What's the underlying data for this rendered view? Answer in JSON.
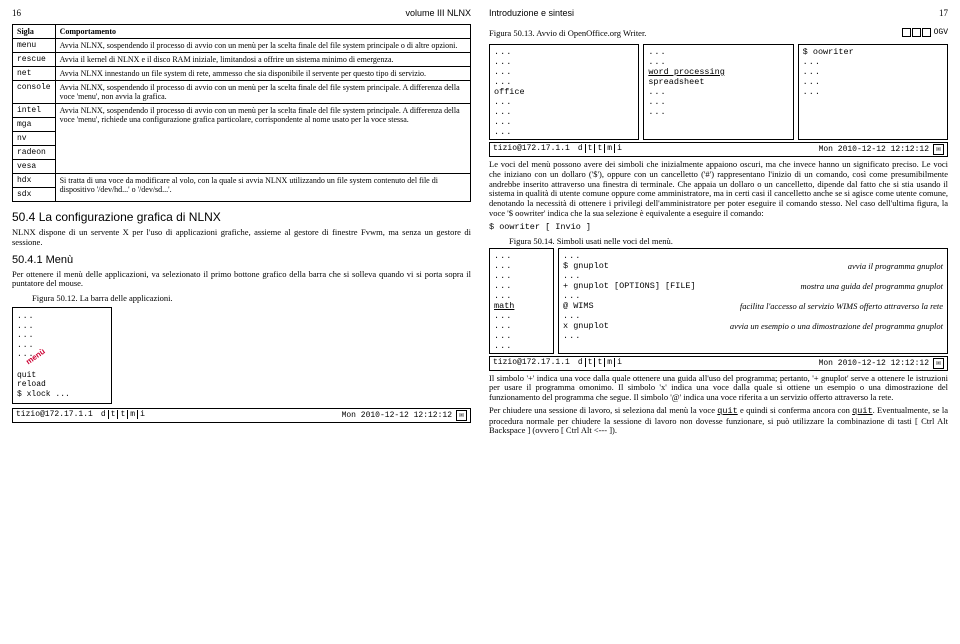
{
  "left_page": {
    "number": "16",
    "header": "volume III   NLNX",
    "sigla_header": "Sigla",
    "comp_header": "Comportamento",
    "rows": [
      {
        "sigla": "menu",
        "comp": "Avvia NLNX, sospendendo il processo di avvio con un menù per la scelta finale del file system principale o di altre opzioni."
      },
      {
        "sigla": "rescue",
        "comp": "Avvia il kernel di NLNX e il disco RAM iniziale, limitandosi a offrire un sistema minimo di emergenza."
      },
      {
        "sigla": "net",
        "comp": "Avvia NLNX innestando un file system di rete, ammesso che sia disponibile il servente per questo tipo di servizio."
      },
      {
        "sigla": "console",
        "comp": "Avvia NLNX, sospendendo il processo di avvio con un menù per la scelta finale del file system principale. A differenza della voce 'menu', non avvia la grafica."
      },
      {
        "sigla": "intel",
        "comp": ""
      },
      {
        "sigla": "mga",
        "comp": ""
      },
      {
        "sigla": "nv",
        "comp": "Avvia NLNX, sospendendo il processo di avvio con un menù per la scelta finale del file system principale. A differenza della voce 'menu', richiede una configurazione grafica particolare, corrispondente al nome usato per la voce stessa."
      },
      {
        "sigla": "radeon",
        "comp": ""
      },
      {
        "sigla": "vesa",
        "comp": ""
      },
      {
        "sigla": "hdx",
        "comp": "Si tratta di una voce da modificare al volo, con la quale si avvia NLNX utilizzando un file system contenuto del file di dispositivo '/dev/hd...' o '/dev/sd...'."
      },
      {
        "sigla": "sdx",
        "comp": ""
      }
    ],
    "sec_50_4": "50.4 La configurazione grafica di NLNX",
    "para_50_4": "NLNX dispone di un servente X per l'uso di applicazioni grafiche, assieme al gestore di finestre Fvwm, ma senza un gestore di sessione.",
    "sec_50_4_1": "50.4.1 Menù",
    "para_50_4_1": "Per ottenere il menù delle applicazioni, va selezionato il primo bottone grafico della barra che si solleva quando vi si porta sopra il puntatore del mouse.",
    "fig_50_12": "Figura 50.12. La barra delle applicazioni.",
    "menu_items": [
      "...",
      "...",
      "...",
      "...",
      "..."
    ],
    "menu_word": "menù",
    "menu_quit": "quit",
    "menu_reload": "reload",
    "menu_xlock": "$ xlock ...",
    "status_user": "tizio@172.17.1.1",
    "status_flags": [
      "d",
      "t",
      "t",
      "m",
      "i"
    ],
    "status_time": "Mon 2010-12-12 12:12:12"
  },
  "right_page": {
    "number": "17",
    "header": "Introduzione e sintesi",
    "fig_50_13": "Figura 50.13. Avvio di OpenOffice.org Writer.",
    "ogv": "OGV",
    "box1_col1": [
      "...",
      "...",
      "...",
      "...",
      "office",
      "...",
      "...",
      "...",
      "..."
    ],
    "box1_col2": [
      "...",
      "...",
      "word processing",
      "spreadsheet",
      "...",
      "...",
      "..."
    ],
    "box1_col3": [
      "$ oowriter",
      "...",
      "...",
      "...",
      "..."
    ],
    "status_user": "tizio@172.17.1.1",
    "status_flags": [
      "d",
      "t",
      "t",
      "m",
      "i"
    ],
    "status_time": "Mon 2010-12-12 12:12:12",
    "para1": "Le voci del menù possono avere dei simboli che inizialmente appaiono oscuri, ma che invece hanno un significato preciso. Le voci che iniziano con un dollaro ('$'), oppure con un cancelletto ('#') rappresentano l'inizio di un comando, così come presumibilmente andrebbe inserito attraverso una finestra di terminale. Che appaia un dollaro o un cancelletto, dipende dal fatto che si stia usando il sistema in qualità di utente comune oppure come amministratore, ma in certi casi il cancelletto anche se si agisce come utente comune, denotando la necessità di ottenere i privilegi dell'amministratore per poter eseguire il comando stesso. Nel caso dell'ultima figura, la voce '$ oowriter' indica che la sua selezione è equivalente a eseguire il comando:",
    "cmd1": "$  oowriter [ Invio ]",
    "fig_50_14": "Figura 50.14. Simboli usati nelle voci del menù.",
    "box2_col1": [
      "...",
      "...",
      "...",
      "...",
      "...",
      "math",
      "...",
      "...",
      "...",
      "..."
    ],
    "box2_rows": [
      {
        "l": "...",
        "r": ""
      },
      {
        "l": "$ gnuplot",
        "r": "avvia il programma gnuplot"
      },
      {
        "l": "...",
        "r": ""
      },
      {
        "l": "+ gnuplot [OPTIONS] [FILE]",
        "r": "mostra una guida del programma gnuplot"
      },
      {
        "l": "...",
        "r": ""
      },
      {
        "l": "@ WIMS",
        "r": "facilita l'accesso al servizio WIMS offerto attraverso la rete"
      },
      {
        "l": "...",
        "r": ""
      },
      {
        "l": "x gnuplot",
        "r": "avvia un esempio o una dimostrazione del programma gnuplot"
      },
      {
        "l": "...",
        "r": ""
      }
    ],
    "para2": "Il simbolo '+' indica una voce dalla quale ottenere una guida all'uso del programma; pertanto, '+ gnuplot' serve a ottenere le istruzioni per usare il programma omonimo. Il simbolo 'x' indica una voce dalla quale si ottiene un esempio o una dimostrazione del funzionamento del programma che segue. Il simbolo '@' indica una voce riferita a un servizio offerto attraverso la rete.",
    "para3a": "Per chiudere una sessione di lavoro, si seleziona dal menù la voce ",
    "para3quit": "quit",
    "para3b": " e quindi si conferma ancora con ",
    "para3c": ". Eventualmente, se la procedura normale per chiudere la sessione di lavoro non dovesse funzionare, si può utilizzare la combinazione di tasti [ Ctrl Alt Backspace ] (ovvero [ Ctrl Alt <--- ])."
  }
}
